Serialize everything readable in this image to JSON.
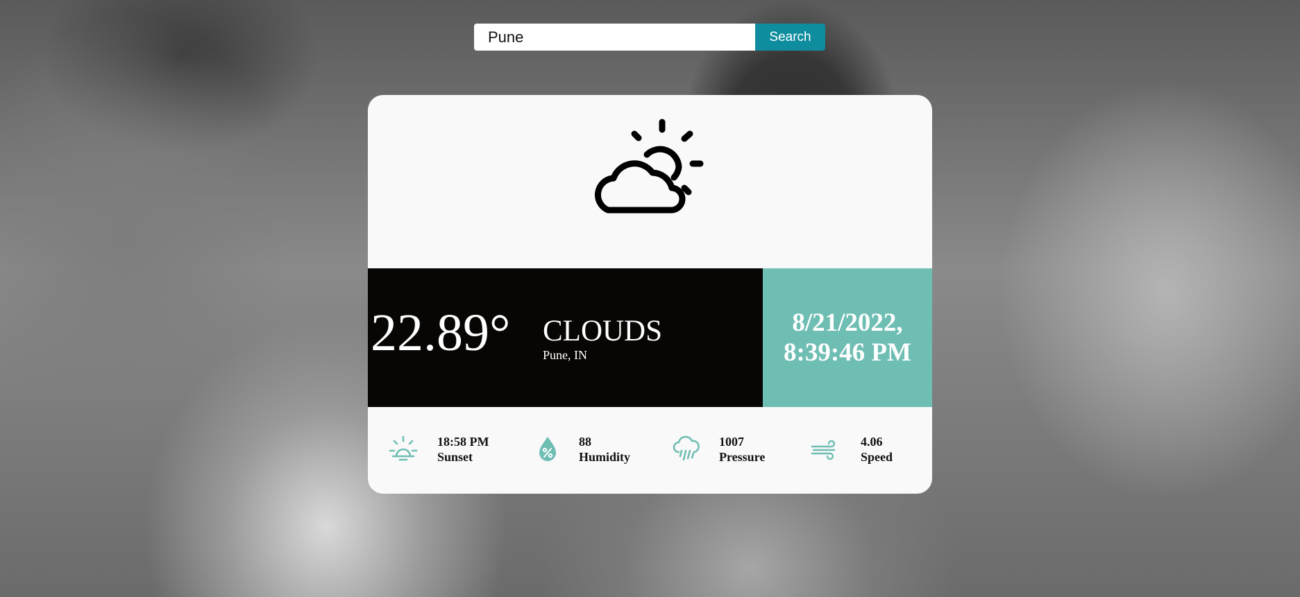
{
  "search": {
    "value": "Pune",
    "button_label": "Search"
  },
  "weather": {
    "icon": "partly-cloudy-icon",
    "temperature": "22.89°",
    "condition": "Clouds",
    "location": "Pune, IN",
    "date_line1": "8/21/2022,",
    "date_line2": "8:39:46 PM"
  },
  "stats": [
    {
      "icon": "sunset-icon",
      "value": "18:58 PM",
      "label": "Sunset"
    },
    {
      "icon": "humidity-icon",
      "value": "88",
      "label": "Humidity"
    },
    {
      "icon": "pressure-rain-cloud-icon",
      "value": "1007",
      "label": "Pressure"
    },
    {
      "icon": "wind-icon",
      "value": "4.06",
      "label": "Speed"
    }
  ],
  "colors": {
    "accent_teal": "#6fbeb3",
    "search_button": "#0e8d9e",
    "band_dark": "#080604",
    "card_bg": "#f9f9f9"
  }
}
